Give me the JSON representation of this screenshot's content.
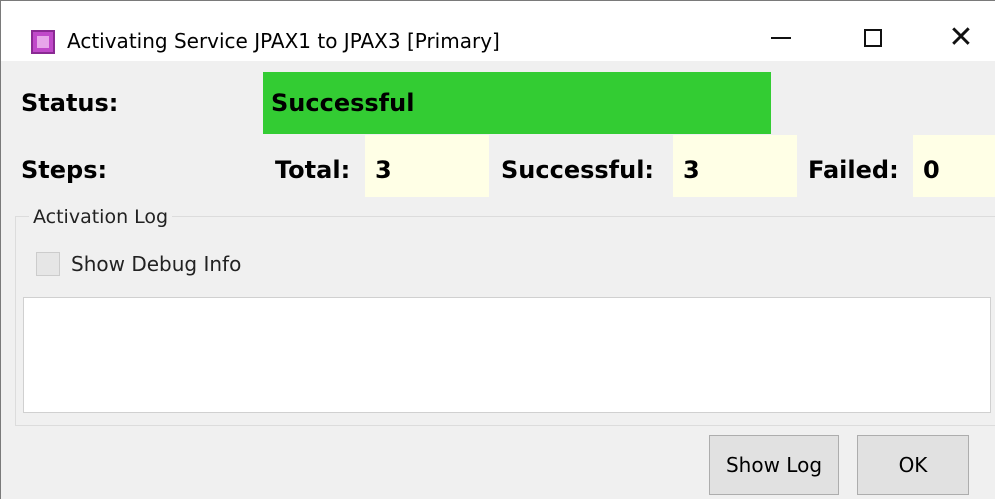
{
  "window": {
    "title": "Activating Service JPAX1 to JPAX3  [Primary]",
    "icon": "app-icon"
  },
  "status": {
    "label": "Status:",
    "value": "Successful",
    "color": "#33cc33"
  },
  "steps": {
    "label": "Steps:",
    "total_label": "Total:",
    "total_value": "3",
    "successful_label": "Successful:",
    "successful_value": "3",
    "failed_label": "Failed:",
    "failed_value": "0"
  },
  "activation_log": {
    "group_label": "Activation Log",
    "debug_checkbox_label": "Show Debug Info",
    "debug_checked": false,
    "log_text": ""
  },
  "buttons": {
    "show_log": "Show Log",
    "ok": "OK"
  }
}
